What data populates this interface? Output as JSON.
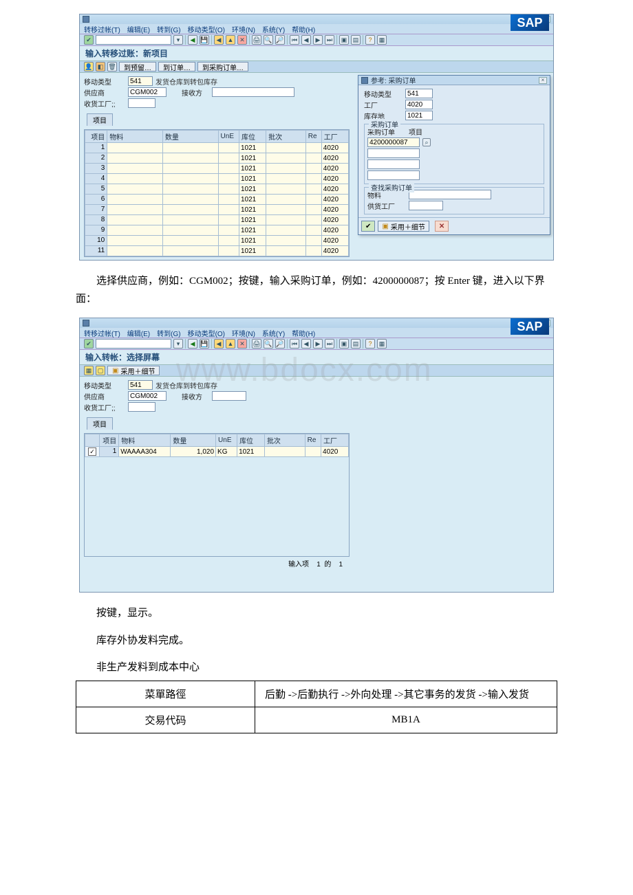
{
  "sap1": {
    "menus": [
      "转移过帐(T)",
      "编辑(E)",
      "转到(G)",
      "移动类型(O)",
      "环境(N)",
      "系统(Y)",
      "帮助(H)"
    ],
    "subtitle": "输入转移过账：新项目",
    "appbar": {
      "btn1": "到预留…",
      "btn2": "到订单…",
      "btn3": "到采购订单…"
    },
    "fields": {
      "move_type_label": "移动类型",
      "move_type": "541",
      "move_type_desc": "发货仓库到转包库存",
      "vendor_label": "供应商",
      "vendor": "CGM002",
      "vendor_after_label": "接收方",
      "rcv_plant_label": "收货工厂;;"
    },
    "grid_tab": "项目",
    "cols": {
      "item": "项目",
      "mat": "物料",
      "qty": "数量",
      "une": "UnE",
      "sloc": "库位",
      "batch": "批次",
      "re": "Re",
      "plant": "工厂"
    },
    "rows": [
      {
        "n": "1",
        "sloc": "1021",
        "plant": "4020"
      },
      {
        "n": "2",
        "sloc": "1021",
        "plant": "4020"
      },
      {
        "n": "3",
        "sloc": "1021",
        "plant": "4020"
      },
      {
        "n": "4",
        "sloc": "1021",
        "plant": "4020"
      },
      {
        "n": "5",
        "sloc": "1021",
        "plant": "4020"
      },
      {
        "n": "6",
        "sloc": "1021",
        "plant": "4020"
      },
      {
        "n": "7",
        "sloc": "1021",
        "plant": "4020"
      },
      {
        "n": "8",
        "sloc": "1021",
        "plant": "4020"
      },
      {
        "n": "9",
        "sloc": "1021",
        "plant": "4020"
      },
      {
        "n": "10",
        "sloc": "1021",
        "plant": "4020"
      },
      {
        "n": "11",
        "sloc": "1021",
        "plant": "4020"
      }
    ],
    "popup": {
      "title": "参考: 采购订单",
      "move_type_label": "移动类型",
      "move_type": "541",
      "plant_label": "工厂",
      "plant": "4020",
      "sloc_label": "库存地",
      "sloc": "1021",
      "sect1": "采购订单",
      "po_label": "采购订单",
      "item_label": "项目",
      "po": "4200000087",
      "sect2": "查找采购订单",
      "mat_label": "物料",
      "supply_plant_label": "供货工厂",
      "foot_btn": "采用＋细节",
      "close": "✕"
    }
  },
  "narr1": "选择供应商，例如：CGM002；按键，输入采购订单，例如：4200000087；按 Enter 键，进入以下界面：",
  "sap2": {
    "menus": [
      "转移过帐(T)",
      "编辑(E)",
      "转到(G)",
      "移动类型(O)",
      "环境(N)",
      "系统(Y)",
      "帮助(H)"
    ],
    "subtitle": "输入转帐：选择屏幕",
    "appbar_btn": "采用＋细节",
    "fields": {
      "move_type_label": "移动类型",
      "move_type": "541",
      "move_type_desc": "发货仓库到转包库存",
      "vendor_label": "供应商",
      "vendor": "CGM002",
      "vendor_after_label": "接收方",
      "rcv_plant_label": "收货工厂;;"
    },
    "grid_tab": "项目",
    "cols": {
      "item": "项目",
      "mat": "物料",
      "qty": "数量",
      "une": "UnE",
      "sloc": "库位",
      "batch": "批次",
      "re": "Re",
      "plant": "工厂"
    },
    "row": {
      "chk": "✓",
      "n": "1",
      "mat": "WAAAA304",
      "qty": "1,020",
      "une": "KG",
      "sloc": "1021",
      "plant": "4020"
    },
    "status": {
      "label": "输入项",
      "a": "1",
      "mid": "的",
      "b": "1"
    }
  },
  "narr2": "按键，显示。",
  "narr3": "库存外协发料完成。",
  "heading": "非生产发料到成本中心",
  "table": {
    "r1c1": "菜單路徑",
    "r1c2": "后勤 ->后勤执行 ->外向处理 ->其它事务的发货 ->输入发货",
    "r2c1": "交易代码",
    "r2c2": "MB1A"
  },
  "watermark": "www.bdocx.com",
  "logo": "SAP"
}
